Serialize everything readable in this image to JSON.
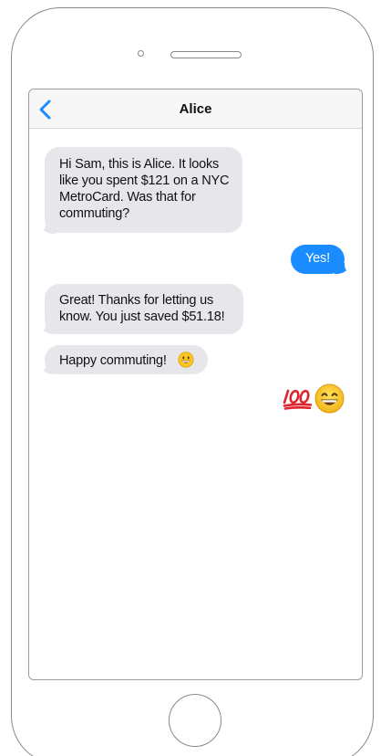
{
  "header": {
    "contact_name": "Alice",
    "back_icon": "chevron-left-icon"
  },
  "messages": [
    {
      "direction": "incoming",
      "text": "Hi Sam, this is Alice. It looks like you spent $121 on a NYC MetroCard. Was that for commuting?"
    },
    {
      "direction": "outgoing",
      "text": "Yes!"
    },
    {
      "direction": "incoming",
      "text": "Great! Thanks for letting us know. You just saved $51.18!"
    },
    {
      "direction": "incoming",
      "text": "Happy commuting!",
      "emoji": "grinning-face-icon"
    },
    {
      "direction": "outgoing",
      "emojis": [
        "hundred-points-icon",
        "grinning-face-with-smiling-eyes-icon"
      ]
    }
  ],
  "colors": {
    "accent": "#1a8cff",
    "incoming_bubble": "#e6e6eb",
    "nav_background": "#f7f7f7"
  }
}
